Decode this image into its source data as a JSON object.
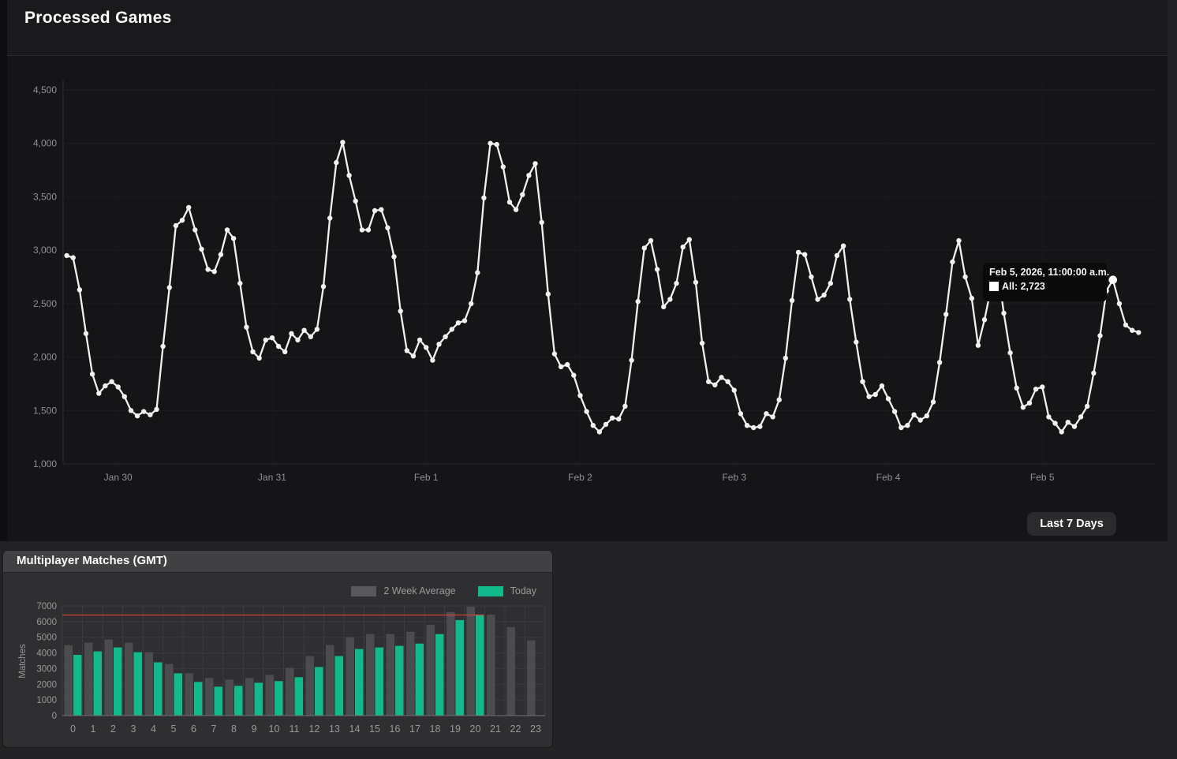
{
  "top_chart": {
    "range_button": "Last 7 Days",
    "tooltip": {
      "title": "Feb 5, 2026, 11:00:00 a.m.",
      "value_text": "All: 2,723"
    }
  },
  "chart_data": [
    {
      "type": "line",
      "title": "Processed Games",
      "series": [
        {
          "name": "All",
          "color": "#f1f1f1",
          "values": [
            2950,
            2930,
            2630,
            2220,
            1840,
            1660,
            1730,
            1770,
            1720,
            1630,
            1500,
            1450,
            1490,
            1460,
            1510,
            2100,
            2650,
            3230,
            3280,
            3400,
            3190,
            3010,
            2820,
            2800,
            2960,
            3190,
            3110,
            2690,
            2280,
            2050,
            1990,
            2160,
            2180,
            2100,
            2050,
            2220,
            2160,
            2250,
            2190,
            2260,
            2660,
            3300,
            3820,
            4010,
            3700,
            3460,
            3190,
            3190,
            3370,
            3380,
            3210,
            2940,
            2430,
            2060,
            2010,
            2160,
            2090,
            1970,
            2120,
            2190,
            2260,
            2320,
            2340,
            2500,
            2790,
            3490,
            4000,
            3990,
            3780,
            3450,
            3380,
            3520,
            3700,
            3810,
            3260,
            2590,
            2030,
            1910,
            1930,
            1830,
            1640,
            1490,
            1360,
            1300,
            1370,
            1430,
            1420,
            1540,
            1970,
            2520,
            3020,
            3090,
            2820,
            2470,
            2540,
            2690,
            3030,
            3100,
            2700,
            2130,
            1770,
            1740,
            1810,
            1770,
            1690,
            1470,
            1360,
            1340,
            1350,
            1470,
            1440,
            1600,
            1990,
            2530,
            2980,
            2960,
            2750,
            2540,
            2580,
            2690,
            2950,
            3040,
            2540,
            2140,
            1770,
            1630,
            1650,
            1730,
            1610,
            1490,
            1340,
            1360,
            1460,
            1410,
            1450,
            1580,
            1950,
            2400,
            2890,
            3090,
            2750,
            2550,
            2110,
            2350,
            2645,
            2850,
            2410,
            2040,
            1710,
            1530,
            1570,
            1700,
            1720,
            1440,
            1380,
            1300,
            1390,
            1350,
            1440,
            1540,
            1850,
            2200,
            2620,
            2723,
            2500,
            2300,
            2250,
            2230
          ]
        }
      ],
      "x_start": "Jan 29, 2026 16:00",
      "x_interval_hours": 1,
      "x_tick_labels": [
        "Jan 30",
        "Jan 31",
        "Feb 1",
        "Feb 2",
        "Feb 3",
        "Feb 4",
        "Feb 5"
      ],
      "x_tick_hours_from_start": [
        8,
        32,
        56,
        80,
        104,
        128,
        152
      ],
      "y_ticks": [
        1000,
        1500,
        2000,
        2500,
        3000,
        3500,
        4000,
        4500
      ],
      "y_tick_labels": [
        "1,000",
        "1,500",
        "2,000",
        "2,500",
        "3,000",
        "3,500",
        "4,000",
        "4,500"
      ],
      "ylim": [
        1000,
        4600
      ],
      "grid": true,
      "highlight": {
        "index": 163,
        "value": 2723,
        "label": "Feb 5, 2026, 11:00:00 a.m.",
        "series": "All",
        "value_label": "2,723"
      }
    },
    {
      "type": "bar",
      "title": "Multiplayer Matches (GMT)",
      "categories": [
        "0",
        "1",
        "2",
        "3",
        "4",
        "5",
        "6",
        "7",
        "8",
        "9",
        "10",
        "11",
        "12",
        "13",
        "14",
        "15",
        "16",
        "17",
        "18",
        "19",
        "20",
        "21",
        "22",
        "23"
      ],
      "series": [
        {
          "name": "2 Week Average",
          "color": "#4c4c4e",
          "values": [
            4500,
            4650,
            4850,
            4650,
            4050,
            3300,
            2700,
            2400,
            2300,
            2400,
            2600,
            3050,
            3800,
            4500,
            5000,
            5200,
            5200,
            5350,
            5800,
            6600,
            6950,
            6450,
            5650,
            4800
          ]
        },
        {
          "name": "Today",
          "color": "#12b98a",
          "values": [
            3880,
            4100,
            4350,
            4050,
            3400,
            2700,
            2150,
            1850,
            1900,
            2100,
            2200,
            2450,
            3100,
            3800,
            4250,
            4350,
            4450,
            4600,
            5200,
            6100,
            6450,
            null,
            null,
            null
          ]
        }
      ],
      "xlabel": "",
      "ylabel": "Matches",
      "y_ticks": [
        0,
        1000,
        2000,
        3000,
        4000,
        5000,
        6000,
        7000
      ],
      "ylim": [
        0,
        7000
      ],
      "grid": true,
      "legend_position": "top-right",
      "reference_line": {
        "value": 6420,
        "color": "#cf4242"
      }
    }
  ]
}
